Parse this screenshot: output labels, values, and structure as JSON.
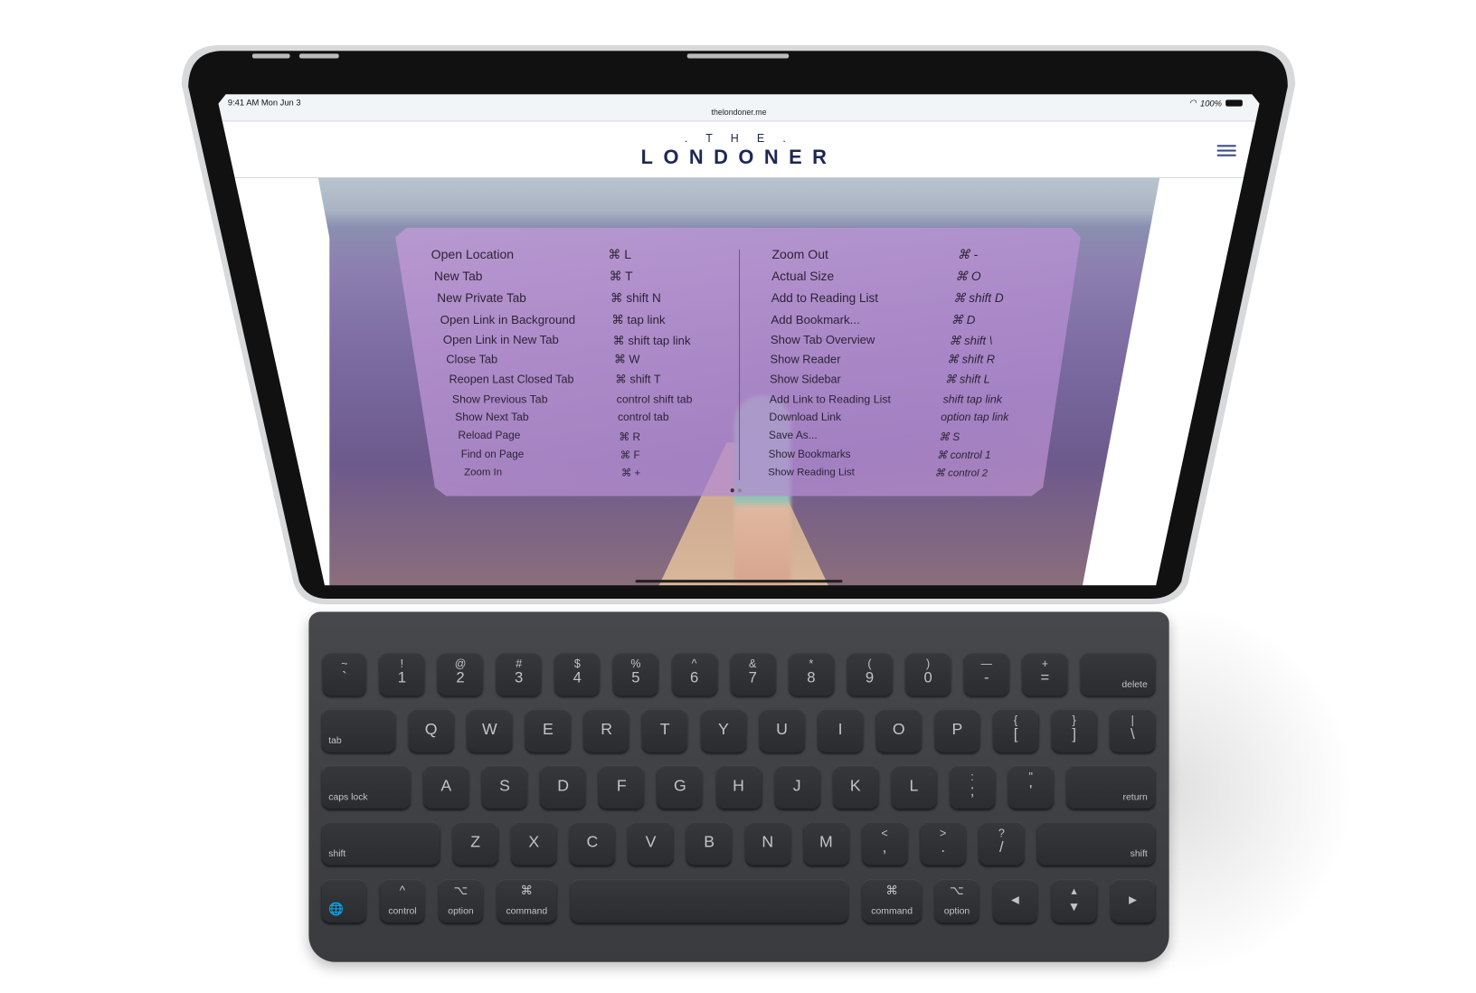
{
  "status_bar": {
    "time": "9:41 AM  Mon Jun 3",
    "url": "thelondoner.me",
    "battery": "100%",
    "wifi_icon": "wifi-icon",
    "battery_icon": "battery-icon"
  },
  "site": {
    "logo_the": ". T H E .",
    "logo_main": "LONDONER",
    "menu_icon": "hamburger-menu-icon"
  },
  "shortcuts": {
    "left": [
      {
        "label": "Open Location",
        "keys": "⌘ L"
      },
      {
        "label": "New Tab",
        "keys": "⌘ T"
      },
      {
        "label": "New Private Tab",
        "keys": "⌘ shift N"
      },
      {
        "label": "Open Link in Background",
        "keys": "⌘ tap link"
      },
      {
        "label": "Open Link in New Tab",
        "keys": "⌘ shift tap link"
      },
      {
        "label": "Close Tab",
        "keys": "⌘ W"
      },
      {
        "label": "Reopen Last Closed Tab",
        "keys": "⌘ shift T"
      },
      {
        "label": "Show Previous Tab",
        "keys": "control shift tab"
      },
      {
        "label": "Show Next Tab",
        "keys": "control tab"
      },
      {
        "label": "Reload Page",
        "keys": "⌘ R"
      },
      {
        "label": "Find on Page",
        "keys": "⌘ F"
      },
      {
        "label": "Zoom In",
        "keys": "⌘ +"
      }
    ],
    "right": [
      {
        "label": "Zoom Out",
        "keys": "⌘ -"
      },
      {
        "label": "Actual Size",
        "keys": "⌘ O"
      },
      {
        "label": "Add to Reading List",
        "keys": "⌘ shift D"
      },
      {
        "label": "Add Bookmark...",
        "keys": "⌘ D"
      },
      {
        "label": "Show Tab Overview",
        "keys": "⌘ shift \\"
      },
      {
        "label": "Show Reader",
        "keys": "⌘ shift R"
      },
      {
        "label": "Show Sidebar",
        "keys": "⌘ shift L"
      },
      {
        "label": "Add Link to Reading List",
        "keys": "shift tap link"
      },
      {
        "label": "Download Link",
        "keys": "option tap link"
      },
      {
        "label": "Save As...",
        "keys": "⌘ S"
      },
      {
        "label": "Show Bookmarks",
        "keys": "⌘ control 1"
      },
      {
        "label": "Show Reading List",
        "keys": "⌘ control 2"
      }
    ]
  },
  "keyboard": {
    "rows": [
      [
        {
          "t": "~",
          "b": "`"
        },
        {
          "t": "!",
          "b": "1"
        },
        {
          "t": "@",
          "b": "2"
        },
        {
          "t": "#",
          "b": "3"
        },
        {
          "t": "$",
          "b": "4"
        },
        {
          "t": "%",
          "b": "5"
        },
        {
          "t": "^",
          "b": "6"
        },
        {
          "t": "&",
          "b": "7"
        },
        {
          "t": "*",
          "b": "8"
        },
        {
          "t": "(",
          "b": "9"
        },
        {
          "t": ")",
          "b": "0"
        },
        {
          "t": "—",
          "b": "-"
        },
        {
          "t": "+",
          "b": "="
        },
        {
          "m": "delete",
          "a": "right"
        }
      ],
      [
        {
          "m": "tab",
          "a": "left"
        },
        {
          "s": "Q"
        },
        {
          "s": "W"
        },
        {
          "s": "E"
        },
        {
          "s": "R"
        },
        {
          "s": "T"
        },
        {
          "s": "Y"
        },
        {
          "s": "U"
        },
        {
          "s": "I"
        },
        {
          "s": "O"
        },
        {
          "s": "P"
        },
        {
          "t": "{",
          "b": "["
        },
        {
          "t": "}",
          "b": "]"
        },
        {
          "t": "|",
          "b": "\\"
        }
      ],
      [
        {
          "m": "caps lock",
          "a": "left"
        },
        {
          "s": "A"
        },
        {
          "s": "S"
        },
        {
          "s": "D"
        },
        {
          "s": "F"
        },
        {
          "s": "G"
        },
        {
          "s": "H"
        },
        {
          "s": "J"
        },
        {
          "s": "K"
        },
        {
          "s": "L"
        },
        {
          "t": ":",
          "b": ";"
        },
        {
          "t": "\"",
          "b": "'"
        },
        {
          "m": "return",
          "a": "right"
        }
      ],
      [
        {
          "m": "shift",
          "a": "left"
        },
        {
          "s": "Z"
        },
        {
          "s": "X"
        },
        {
          "s": "C"
        },
        {
          "s": "V"
        },
        {
          "s": "B"
        },
        {
          "s": "N"
        },
        {
          "s": "M"
        },
        {
          "t": "<",
          "b": ","
        },
        {
          "t": ">",
          "b": "."
        },
        {
          "t": "?",
          "b": "/"
        },
        {
          "m": "shift",
          "a": "right"
        }
      ],
      [
        {
          "m": "🌐",
          "a": "left",
          "icon": "globe-icon"
        },
        {
          "sym": "^",
          "m": "control",
          "a": "center"
        },
        {
          "sym": "⌥",
          "m": "option",
          "a": "center"
        },
        {
          "sym": "⌘",
          "m": "command",
          "a": "center"
        },
        {
          "space": true
        },
        {
          "sym": "⌘",
          "m": "command",
          "a": "center"
        },
        {
          "sym": "⌥",
          "m": "option",
          "a": "center"
        },
        {
          "s": "◂"
        },
        {
          "t": "▴",
          "b": "▾"
        },
        {
          "s": "▸"
        }
      ]
    ]
  }
}
